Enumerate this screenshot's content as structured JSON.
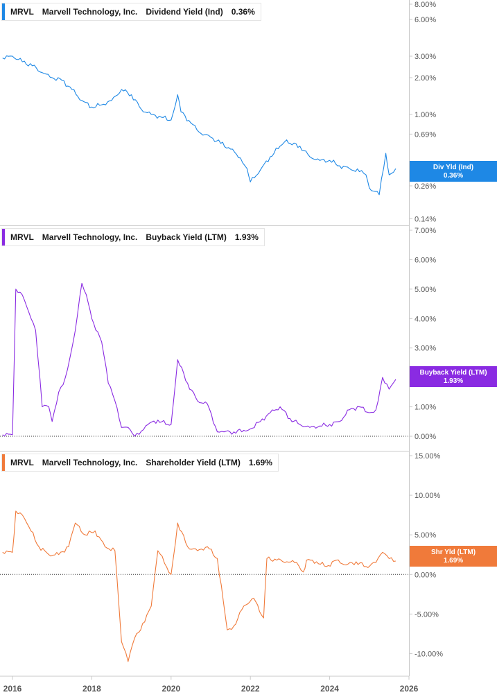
{
  "colors": {
    "div": "#1e88e5",
    "buyback": "#8a2be2",
    "shareholder": "#f07a3a",
    "axis_text": "#555555",
    "grid": "#c9c9c9"
  },
  "panels": [
    {
      "ticker": "MRVL",
      "company": "Marvell Technology, Inc.",
      "metric": "Dividend Yield (Ind)",
      "value": "0.36%",
      "badge_line1": "Div Yld (Ind)",
      "badge_line2": "0.36%"
    },
    {
      "ticker": "MRVL",
      "company": "Marvell Technology, Inc.",
      "metric": "Buyback Yield (LTM)",
      "value": "1.93%",
      "badge_line1": "Buyback Yield (LTM)",
      "badge_line2": "1.93%"
    },
    {
      "ticker": "MRVL",
      "company": "Marvell Technology, Inc.",
      "metric": "Shareholder Yield (LTM)",
      "value": "1.69%",
      "badge_line1": "Shr Yld (LTM)",
      "badge_line2": "1.69%"
    }
  ],
  "x_axis": {
    "ticks": [
      "2016",
      "2018",
      "2020",
      "2022",
      "2024",
      "2026"
    ]
  },
  "chart_data": [
    {
      "type": "line",
      "title": "Dividend Yield (Ind)",
      "scale": "log",
      "ylim": [
        0.13,
        8.0
      ],
      "ytick_labels": [
        "8.00%",
        "6.00%",
        "3.00%",
        "2.00%",
        "1.00%",
        "0.69%",
        "0.26%",
        "0.14%"
      ],
      "ytick_values": [
        8.0,
        6.0,
        3.0,
        2.0,
        1.0,
        0.69,
        0.26,
        0.14
      ],
      "xlim": [
        "2015-10",
        "2026-01"
      ],
      "series": [
        {
          "x": [
            "2015-10",
            "2016-01",
            "2016-04",
            "2016-07",
            "2016-10",
            "2017-01",
            "2017-04",
            "2017-07",
            "2017-10",
            "2018-01",
            "2018-04",
            "2018-07",
            "2018-10",
            "2019-01",
            "2019-04",
            "2019-07",
            "2019-10",
            "2020-01",
            "2020-03",
            "2020-04",
            "2020-07",
            "2020-10",
            "2021-01",
            "2021-04",
            "2021-07",
            "2021-10",
            "2021-12",
            "2022-01",
            "2022-04",
            "2022-07",
            "2022-10",
            "2022-12",
            "2023-01",
            "2023-04",
            "2023-07",
            "2023-10",
            "2024-01",
            "2024-04",
            "2024-07",
            "2024-10",
            "2024-12",
            "2025-01",
            "2025-04",
            "2025-06",
            "2025-07",
            "2025-09"
          ],
          "values": [
            2.9,
            3.0,
            2.7,
            2.5,
            2.2,
            2.0,
            1.9,
            1.6,
            1.3,
            1.15,
            1.2,
            1.3,
            1.6,
            1.45,
            1.1,
            1.0,
            0.95,
            0.9,
            1.45,
            1.05,
            0.85,
            0.7,
            0.65,
            0.58,
            0.52,
            0.44,
            0.36,
            0.28,
            0.35,
            0.45,
            0.55,
            0.62,
            0.58,
            0.55,
            0.45,
            0.42,
            0.42,
            0.38,
            0.36,
            0.34,
            0.32,
            0.25,
            0.22,
            0.48,
            0.32,
            0.36
          ]
        }
      ]
    },
    {
      "type": "line",
      "title": "Buyback Yield (LTM)",
      "ylim": [
        -0.4,
        7.0
      ],
      "ytick_labels": [
        "7.00%",
        "6.00%",
        "5.00%",
        "4.00%",
        "3.00%",
        "1.00%",
        "0.00%"
      ],
      "ytick_values": [
        7.0,
        6.0,
        5.0,
        4.0,
        3.0,
        1.0,
        0.0
      ],
      "series": [
        {
          "x": [
            "2015-10",
            "2016-01",
            "2016-02",
            "2016-04",
            "2016-06",
            "2016-08",
            "2016-10",
            "2016-12",
            "2017-01",
            "2017-03",
            "2017-05",
            "2017-07",
            "2017-08",
            "2017-10",
            "2017-12",
            "2018-01",
            "2018-04",
            "2018-06",
            "2018-08",
            "2018-10",
            "2018-12",
            "2019-02",
            "2019-06",
            "2019-09",
            "2019-12",
            "2020-01",
            "2020-03",
            "2020-06",
            "2020-09",
            "2020-12",
            "2021-03",
            "2021-05",
            "2021-08",
            "2021-11",
            "2022-01",
            "2022-04",
            "2022-07",
            "2022-10",
            "2023-01",
            "2023-04",
            "2023-07",
            "2023-10",
            "2024-01",
            "2024-04",
            "2024-07",
            "2024-10",
            "2025-01",
            "2025-03",
            "2025-05",
            "2025-07",
            "2025-09"
          ],
          "values": [
            0.05,
            0.05,
            5.0,
            4.8,
            4.2,
            3.6,
            1.0,
            1.0,
            0.5,
            1.5,
            2.0,
            3.0,
            3.6,
            5.2,
            4.5,
            4.0,
            3.2,
            1.8,
            1.2,
            0.3,
            0.3,
            0.0,
            0.4,
            0.55,
            0.4,
            0.4,
            2.6,
            1.8,
            1.2,
            1.1,
            0.15,
            0.15,
            0.15,
            0.2,
            0.25,
            0.5,
            0.8,
            1.0,
            0.6,
            0.4,
            0.3,
            0.35,
            0.4,
            0.5,
            0.9,
            1.0,
            0.8,
            0.9,
            2.0,
            1.6,
            1.93
          ]
        }
      ]
    },
    {
      "type": "line",
      "title": "Shareholder Yield (LTM)",
      "ylim": [
        -12.5,
        15.0
      ],
      "ytick_labels": [
        "15.00%",
        "10.00%",
        "5.00%",
        "0.00%",
        "-5.00%",
        "-10.00%"
      ],
      "ytick_values": [
        15.0,
        10.0,
        5.0,
        0.0,
        -5.0,
        -10.0
      ],
      "series": [
        {
          "x": [
            "2015-10",
            "2016-01",
            "2016-02",
            "2016-04",
            "2016-06",
            "2016-09",
            "2016-12",
            "2017-03",
            "2017-06",
            "2017-08",
            "2017-11",
            "2018-02",
            "2018-05",
            "2018-08",
            "2018-10",
            "2018-12",
            "2019-02",
            "2019-05",
            "2019-07",
            "2019-09",
            "2020-01",
            "2020-03",
            "2020-06",
            "2020-09",
            "2020-12",
            "2021-03",
            "2021-06",
            "2021-08",
            "2021-11",
            "2022-02",
            "2022-05",
            "2022-06",
            "2022-09",
            "2022-12",
            "2023-03",
            "2023-05",
            "2023-06",
            "2023-09",
            "2023-12",
            "2024-03",
            "2024-06",
            "2024-09",
            "2024-12",
            "2025-03",
            "2025-05",
            "2025-07",
            "2025-09"
          ],
          "values": [
            2.8,
            2.8,
            8.0,
            7.5,
            6.0,
            3.5,
            2.5,
            2.5,
            3.5,
            6.5,
            5.0,
            5.5,
            3.5,
            3.0,
            -8.5,
            -11.0,
            -8.0,
            -6.0,
            -4.0,
            3.0,
            0.0,
            6.5,
            3.5,
            3.0,
            3.5,
            2.0,
            -7.0,
            -6.5,
            -4.0,
            -3.0,
            -5.5,
            2.0,
            1.8,
            1.6,
            1.5,
            0.3,
            1.8,
            1.6,
            1.0,
            1.8,
            1.2,
            1.6,
            1.0,
            1.5,
            2.8,
            2.0,
            1.69
          ]
        }
      ]
    }
  ]
}
